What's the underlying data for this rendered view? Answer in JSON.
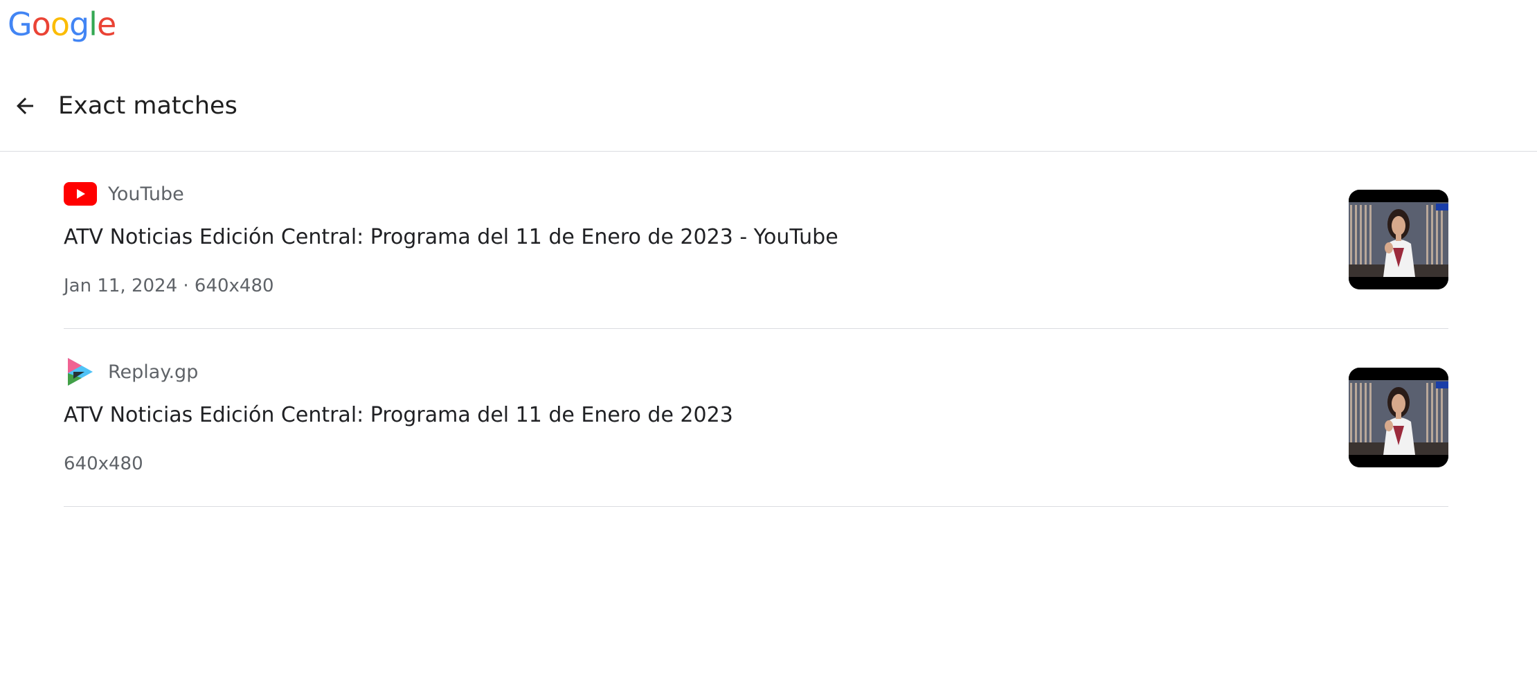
{
  "logo": {
    "letters": [
      "G",
      "o",
      "o",
      "g",
      "l",
      "e"
    ],
    "colors": [
      "#4285F4",
      "#EA4335",
      "#FBBC05",
      "#4285F4",
      "#34A853",
      "#EA4335"
    ]
  },
  "header": {
    "back_icon": "arrow-left-icon",
    "title": "Exact matches"
  },
  "results": [
    {
      "source": "YouTube",
      "favicon": "youtube-icon",
      "title": "ATV Noticias Edición Central: Programa del 11 de Enero de 2023 - YouTube",
      "meta": "Jan 11, 2024 · 640x480"
    },
    {
      "source": "Replay.gp",
      "favicon": "replay-play-icon",
      "title": "ATV Noticias Edición Central: Programa del 11 de Enero de 2023",
      "meta": "640x480"
    }
  ],
  "colors": {
    "divider": "#dadce0",
    "youtube_red": "#FF0000",
    "secondary_text": "#5f6368"
  }
}
